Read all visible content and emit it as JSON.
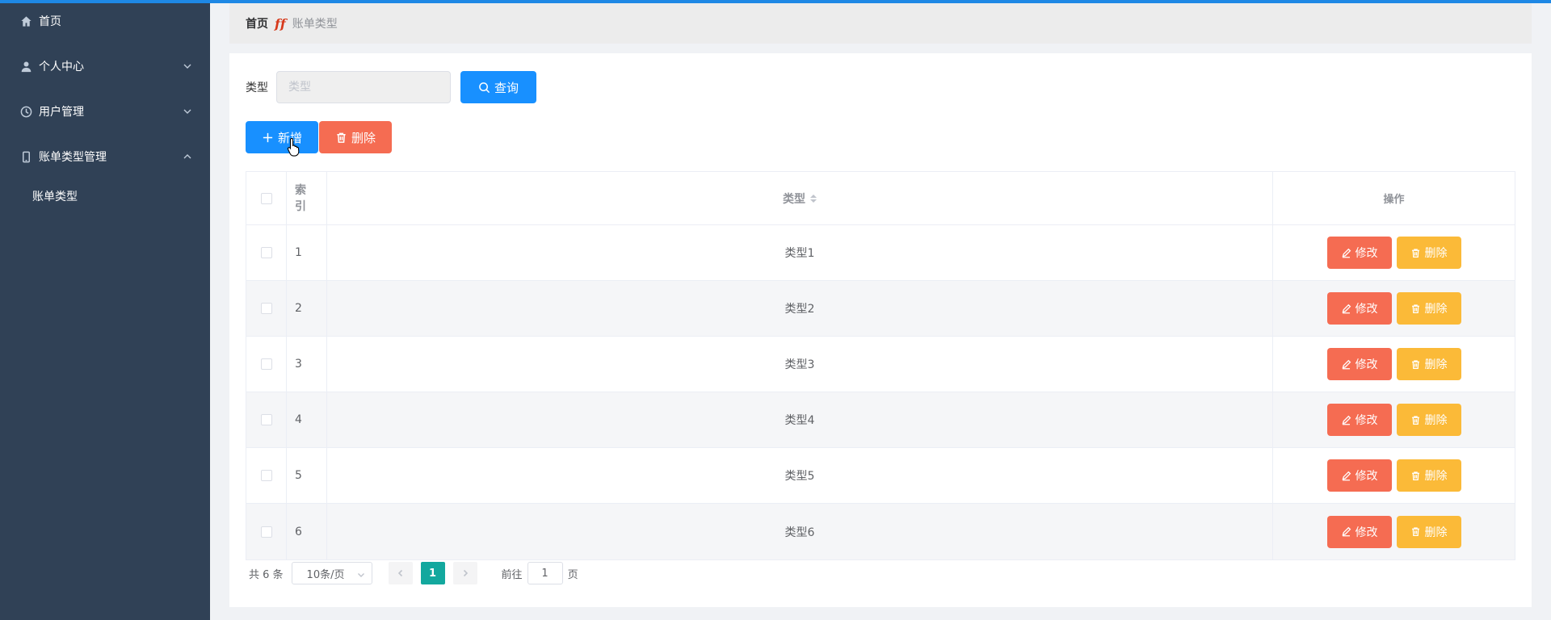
{
  "sidebar": {
    "items": [
      {
        "label": "首页",
        "icon": "home-icon",
        "has_chevron": false
      },
      {
        "label": "个人中心",
        "icon": "user-icon",
        "chevron": "down"
      },
      {
        "label": "用户管理",
        "icon": "clock-icon",
        "chevron": "down"
      },
      {
        "label": "账单类型管理",
        "icon": "phone-icon",
        "chevron": "up"
      }
    ],
    "submenu": [
      {
        "label": "账单类型"
      }
    ]
  },
  "breadcrumb": {
    "home": "首页",
    "separator": "𝒇𝒇",
    "current": "账单类型"
  },
  "search": {
    "label": "类型",
    "placeholder": "类型",
    "button_label": "查询"
  },
  "actions": {
    "add_label": "新增",
    "delete_label": "删除"
  },
  "table": {
    "headers": {
      "index": "索\n引",
      "type": "类型",
      "operation": "操作"
    },
    "rows": [
      {
        "index": "1",
        "type": "类型1"
      },
      {
        "index": "2",
        "type": "类型2"
      },
      {
        "index": "3",
        "type": "类型3"
      },
      {
        "index": "4",
        "type": "类型4"
      },
      {
        "index": "5",
        "type": "类型5"
      },
      {
        "index": "6",
        "type": "类型6"
      }
    ],
    "edit_label": "修改",
    "row_delete_label": "删除"
  },
  "pagination": {
    "total_text": "共 6 条",
    "page_size": "10条/页",
    "current_page": "1",
    "goto_prefix": "前往",
    "goto_value": "1",
    "goto_suffix": "页"
  },
  "colors": {
    "sidebar_bg": "#304156",
    "primary": "#1890ff",
    "danger": "#f56c52",
    "warning": "#fbba38",
    "page_active": "#13a89e"
  }
}
